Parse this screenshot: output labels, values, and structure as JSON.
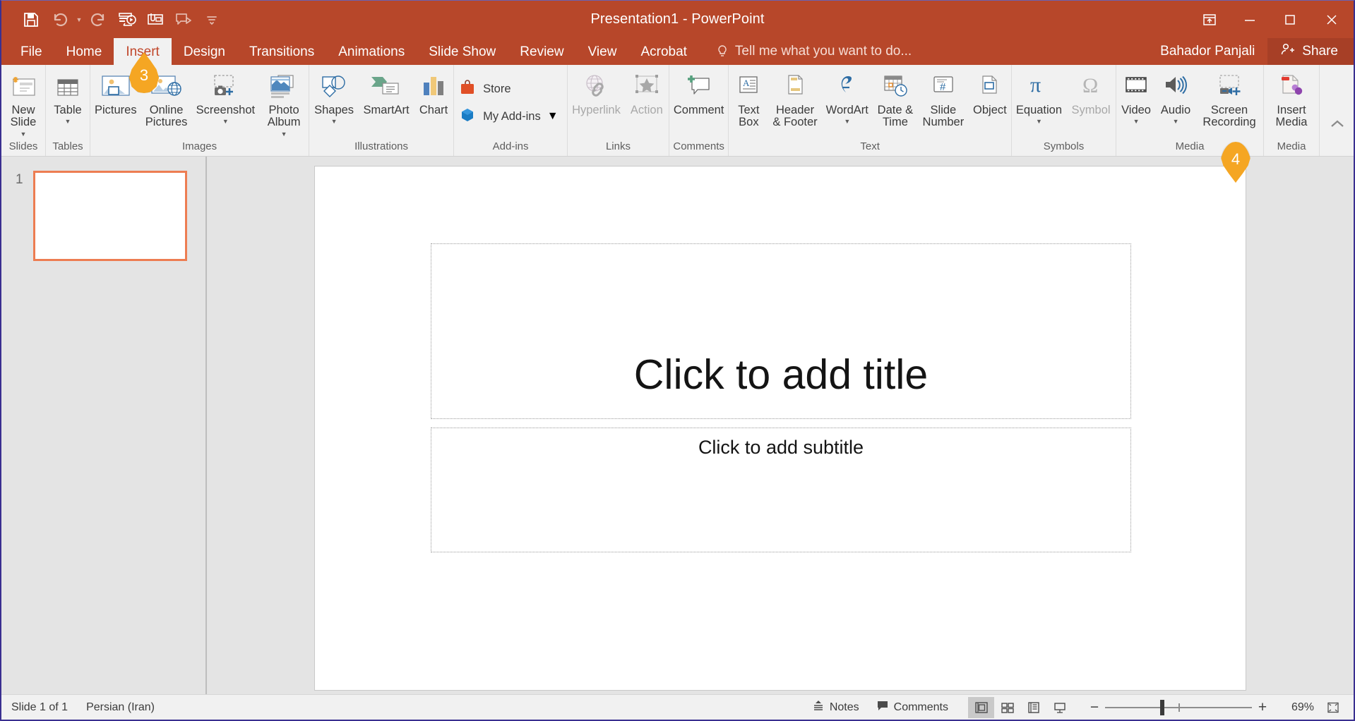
{
  "window": {
    "title": "Presentation1  -  PowerPoint",
    "user": "Bahador Panjali",
    "share_label": "Share"
  },
  "quick_access": [
    {
      "name": "save-icon",
      "label": "Save"
    },
    {
      "name": "undo-icon",
      "label": "Undo"
    },
    {
      "name": "redo-icon",
      "label": "Repeat"
    },
    {
      "name": "start-from-beginning-icon",
      "label": "Start From Beginning"
    },
    {
      "name": "open-recent-icon",
      "label": "Open Recent File"
    },
    {
      "name": "start-from-current-icon",
      "label": "Start From Current Slide"
    },
    {
      "name": "customize-qat-icon",
      "label": "Customize Quick Access Toolbar"
    }
  ],
  "window_controls": {
    "ribbon_display": "Ribbon Display Options",
    "minimize": "Minimize",
    "restore": "Restore Down",
    "close": "Close"
  },
  "tabs": [
    {
      "label": "File",
      "active": false
    },
    {
      "label": "Home",
      "active": false
    },
    {
      "label": "Insert",
      "active": true
    },
    {
      "label": "Design",
      "active": false
    },
    {
      "label": "Transitions",
      "active": false
    },
    {
      "label": "Animations",
      "active": false
    },
    {
      "label": "Slide Show",
      "active": false
    },
    {
      "label": "Review",
      "active": false
    },
    {
      "label": "View",
      "active": false
    },
    {
      "label": "Acrobat",
      "active": false
    }
  ],
  "tell_me": {
    "placeholder": "Tell me what you want to do..."
  },
  "ribbon": {
    "groups": [
      {
        "label": "Slides",
        "items": [
          {
            "label": "New\nSlide",
            "icon": "new-slide-icon",
            "caret": true,
            "disabled": false
          }
        ]
      },
      {
        "label": "Tables",
        "items": [
          {
            "label": "Table",
            "icon": "table-icon",
            "caret": true,
            "disabled": false
          }
        ]
      },
      {
        "label": "Images",
        "items": [
          {
            "label": "Pictures",
            "icon": "pictures-icon",
            "caret": false,
            "disabled": false
          },
          {
            "label": "Online\nPictures",
            "icon": "online-pictures-icon",
            "caret": false,
            "disabled": false
          },
          {
            "label": "Screenshot",
            "icon": "screenshot-icon",
            "caret": true,
            "disabled": false
          },
          {
            "label": "Photo\nAlbum",
            "icon": "photo-album-icon",
            "caret": true,
            "disabled": false
          }
        ]
      },
      {
        "label": "Illustrations",
        "items": [
          {
            "label": "Shapes",
            "icon": "shapes-icon",
            "caret": true,
            "disabled": false
          },
          {
            "label": "SmartArt",
            "icon": "smartart-icon",
            "caret": false,
            "disabled": false
          },
          {
            "label": "Chart",
            "icon": "chart-icon",
            "caret": false,
            "disabled": false
          }
        ]
      },
      {
        "label": "Add-ins",
        "items": [
          {
            "label": "Store",
            "icon": "store-icon",
            "caret": false,
            "disabled": false
          },
          {
            "label": "My Add-ins",
            "icon": "my-addins-icon",
            "caret": true,
            "disabled": false
          }
        ]
      },
      {
        "label": "Links",
        "items": [
          {
            "label": "Hyperlink",
            "icon": "hyperlink-icon",
            "caret": false,
            "disabled": true
          },
          {
            "label": "Action",
            "icon": "action-icon",
            "caret": false,
            "disabled": true
          }
        ]
      },
      {
        "label": "Comments",
        "items": [
          {
            "label": "Comment",
            "icon": "comment-icon",
            "caret": false,
            "disabled": false
          }
        ]
      },
      {
        "label": "Text",
        "items": [
          {
            "label": "Text\nBox",
            "icon": "text-box-icon",
            "caret": false,
            "disabled": false
          },
          {
            "label": "Header\n& Footer",
            "icon": "header-footer-icon",
            "caret": false,
            "disabled": false
          },
          {
            "label": "WordArt",
            "icon": "wordart-icon",
            "caret": true,
            "disabled": false
          },
          {
            "label": "Date &\nTime",
            "icon": "date-time-icon",
            "caret": false,
            "disabled": false
          },
          {
            "label": "Slide\nNumber",
            "icon": "slide-number-icon",
            "caret": false,
            "disabled": false
          },
          {
            "label": "Object",
            "icon": "object-icon",
            "caret": false,
            "disabled": false
          }
        ]
      },
      {
        "label": "Symbols",
        "items": [
          {
            "label": "Equation",
            "icon": "equation-icon",
            "caret": true,
            "disabled": false
          },
          {
            "label": "Symbol",
            "icon": "symbol-icon",
            "caret": false,
            "disabled": true
          }
        ]
      },
      {
        "label": "Media",
        "items": [
          {
            "label": "Video",
            "icon": "video-icon",
            "caret": true,
            "disabled": false
          },
          {
            "label": "Audio",
            "icon": "audio-icon",
            "caret": true,
            "disabled": false
          },
          {
            "label": "Screen\nRecording",
            "icon": "screen-recording-icon",
            "caret": false,
            "disabled": false
          }
        ]
      },
      {
        "label": "Media",
        "items": [
          {
            "label": "Insert\nMedia",
            "icon": "insert-media-icon",
            "caret": false,
            "disabled": false
          }
        ]
      }
    ],
    "collapse_label": "Collapse the Ribbon"
  },
  "badges": [
    {
      "number": "3",
      "target": "pictures-online-pictures"
    },
    {
      "number": "4",
      "target": "screen-recording"
    }
  ],
  "slides_pane": {
    "slides": [
      {
        "number": "1",
        "selected": true
      }
    ]
  },
  "slide": {
    "title_placeholder": "Click to add title",
    "subtitle_placeholder": "Click to add subtitle"
  },
  "status_bar": {
    "slide_count": "Slide 1 of 1",
    "language": "Persian (Iran)",
    "notes_label": "Notes",
    "comments_label": "Comments",
    "zoom_level": "69%",
    "views": [
      {
        "name": "normal-view",
        "active": true
      },
      {
        "name": "slide-sorter-view",
        "active": false
      },
      {
        "name": "reading-view",
        "active": false
      },
      {
        "name": "slide-show-view",
        "active": false
      }
    ],
    "fit_label": "Fit slide to current window"
  },
  "colors": {
    "brand": "#b7472a",
    "tab_active_text": "#c0462a",
    "badge": "#f5a623",
    "slide_selected_border": "#ed7d52",
    "ribbon_bg": "#f1f1f1"
  }
}
